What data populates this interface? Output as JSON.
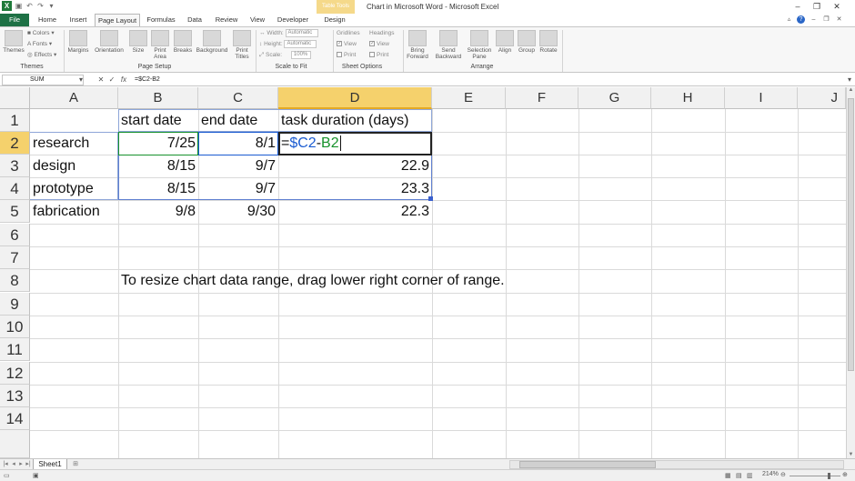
{
  "window": {
    "title": "Chart in Microsoft Word  -  Microsoft Excel",
    "context_tab": "Table Tools"
  },
  "tabs": [
    "File",
    "Home",
    "Insert",
    "Page Layout",
    "Formulas",
    "Data",
    "Review",
    "View",
    "Developer",
    "Design"
  ],
  "active_tab": "Page Layout",
  "ribbon": {
    "themes_group": {
      "label": "Themes",
      "themes": "Themes",
      "colors": "Colors",
      "fonts": "Fonts",
      "effects": "Effects"
    },
    "page_setup_group": {
      "label": "Page Setup",
      "buttons": [
        "Margins",
        "Orientation",
        "Size",
        "Print\nArea",
        "Breaks",
        "Background",
        "Print\nTitles"
      ]
    },
    "scale_group": {
      "label": "Scale to Fit",
      "width_label": "Width:",
      "width_value": "Automatic",
      "height_label": "Height:",
      "height_value": "Automatic",
      "scale_label": "Scale:",
      "scale_value": "100%"
    },
    "sheet_options_group": {
      "label": "Sheet Options",
      "gridlines": "Gridlines",
      "headings": "Headings",
      "view": "View",
      "print": "Print"
    },
    "arrange_group": {
      "label": "Arrange",
      "buttons": [
        "Bring\nForward",
        "Send\nBackward",
        "Selection\nPane",
        "Align",
        "Group",
        "Rotate"
      ]
    }
  },
  "formula_bar": {
    "name_box": "SUM",
    "formula": "=$C2-B2"
  },
  "columns": [
    "A",
    "B",
    "C",
    "D",
    "E",
    "F",
    "G",
    "H",
    "I",
    "J"
  ],
  "rows": [
    "1",
    "2",
    "3",
    "4",
    "5",
    "6",
    "7",
    "8",
    "9",
    "10",
    "11",
    "12",
    "13",
    "14"
  ],
  "cells": {
    "B1": "start date",
    "C1": "end date",
    "D1": "task duration (days)",
    "A2": "research",
    "B2": "7/25",
    "C2": "8/1",
    "D2_prefix": "=",
    "D2_ref1": "$C2",
    "D2_op": "-",
    "D2_ref2": "B2",
    "A3": "design",
    "B3": "8/15",
    "C3": "9/7",
    "D3": "22.9",
    "A4": "prototype",
    "B4": "8/15",
    "C4": "9/7",
    "D4": "23.3",
    "A5": "fabrication",
    "B5": "9/8",
    "C5": "9/30",
    "D5": "22.3",
    "B8": "To resize chart data range, drag lower right corner of range."
  },
  "sheet_tab": "Sheet1",
  "status": {
    "zoom": "214%"
  },
  "colors": {
    "ref_blue": "#1a5bd1",
    "ref_green": "#17922c",
    "header_selected": "#f5d16c",
    "file_tab": "#1e7145"
  }
}
